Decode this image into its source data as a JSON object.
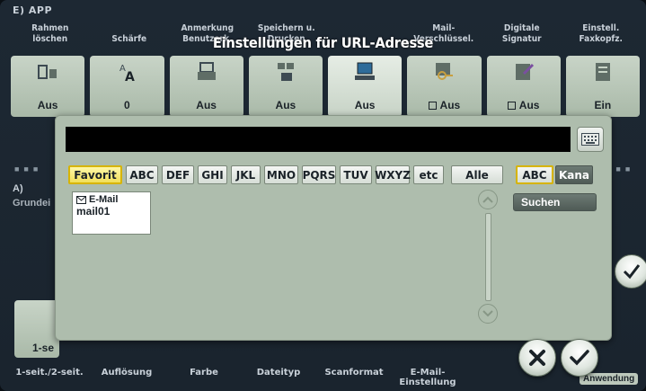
{
  "background": {
    "app_label": "E)  APP",
    "tabs": [
      "Rahmen\nlöschen",
      "Schärfe",
      "Anmerkung\nBenutzerk.",
      "Speichern u.\nDrucken",
      "",
      "Mail-\nVerschlüssel.",
      "Digitale\nSignatur",
      "Einstell.\nFaxkopfz."
    ],
    "icons": [
      {
        "icon": "frame-erase-icon",
        "value": "Aus",
        "checkbox": false,
        "active": false
      },
      {
        "icon": "sharpness-icon",
        "value": "0",
        "checkbox": false,
        "active": false
      },
      {
        "icon": "stamp-icon",
        "value": "Aus",
        "checkbox": false,
        "active": false
      },
      {
        "icon": "save-print-icon",
        "value": "Aus",
        "checkbox": false,
        "active": false
      },
      {
        "icon": "url-computer-icon",
        "value": "Aus",
        "checkbox": false,
        "active": true
      },
      {
        "icon": "encryption-key-icon",
        "value": "Aus",
        "checkbox": true,
        "active": false
      },
      {
        "icon": "digital-signature-icon",
        "value": "Aus",
        "checkbox": true,
        "active": false
      },
      {
        "icon": "fax-header-icon",
        "value": "Ein",
        "checkbox": false,
        "active": false
      }
    ],
    "side_label_a": "A)",
    "side_label_g": "Grundei",
    "left_stub_text": "1-se",
    "bottom_tabs": [
      "1-seit./2-seit.",
      "Auflösung",
      "Farbe",
      "Dateityp",
      "Scanformat",
      "E-Mail-\nEinstellung"
    ],
    "anwendung": "Anwendung"
  },
  "dialog": {
    "title": "Einstellungen für URL-Adresse",
    "address_value": "",
    "filters": [
      "Favorit",
      "ABC",
      "DEF",
      "GHI",
      "JKL",
      "MNO",
      "PQRS",
      "TUV",
      "WXYZ",
      "etc",
      "Alle"
    ],
    "selected_filter": "Favorit",
    "mode_abc": "ABC",
    "mode_kana": "Kana",
    "search_label": "Suchen",
    "entries": [
      {
        "type": "E-Mail",
        "name": "mail01"
      }
    ]
  },
  "colors": {
    "panel": "#aebdad",
    "selected": "#f1df5a",
    "dark_bg": "#1d2833"
  }
}
